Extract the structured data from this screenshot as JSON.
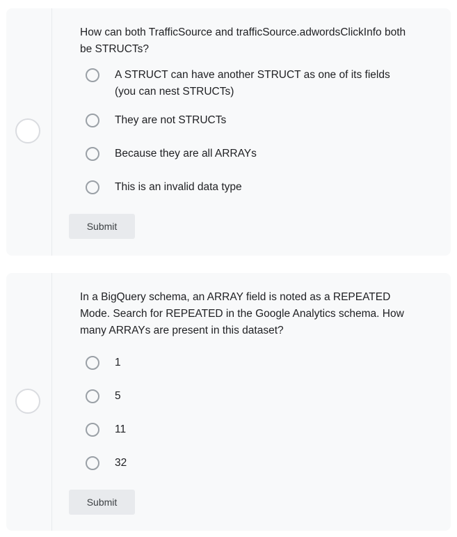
{
  "questions": [
    {
      "text": "How can both TrafficSource and trafficSource.adwordsClickInfo both be STRUCTs?",
      "options": [
        "A STRUCT can have another STRUCT as one of its fields (you can nest STRUCTs)",
        "They are not STRUCTs",
        "Because they are all ARRAYs",
        "This is an invalid data type"
      ],
      "submit_label": "Submit"
    },
    {
      "text": "In a BigQuery schema, an ARRAY field is noted as a REPEATED Mode. Search for REPEATED in the Google Analytics schema. How many ARRAYs are present in this dataset?",
      "options": [
        "1",
        "5",
        "11",
        "32"
      ],
      "submit_label": "Submit"
    }
  ],
  "colors": {
    "card_background": "#f8f9fa",
    "button_background": "#e8eaed",
    "radio_border": "#9aa0a6"
  }
}
